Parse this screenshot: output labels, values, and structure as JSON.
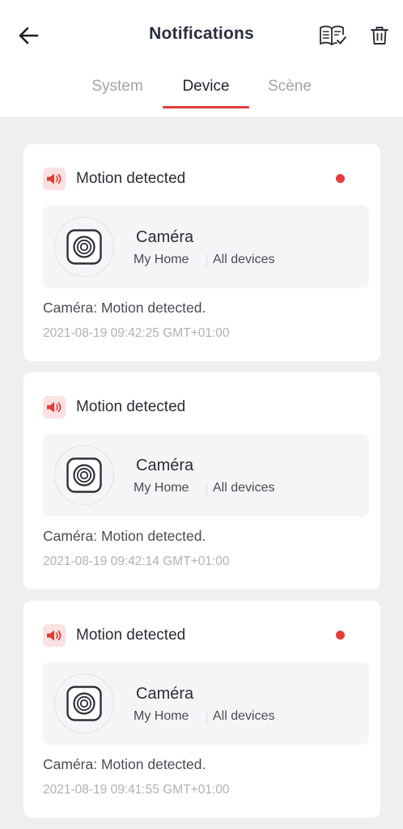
{
  "header": {
    "title": "Notifications",
    "back_icon": "arrow-left-icon",
    "mark_read_icon": "book-check-icon",
    "delete_icon": "trash-icon"
  },
  "tabs": [
    {
      "label": "System",
      "active": false
    },
    {
      "label": "Device",
      "active": true
    },
    {
      "label": "Scène",
      "active": false
    }
  ],
  "colors": {
    "accent": "#e23c3c",
    "title": "#2a2f3d",
    "background": "#efefef",
    "card": "#ffffff",
    "muted": "#b0b0b6"
  },
  "notifications": [
    {
      "title": "Motion detected",
      "unread": true,
      "device_name": "Caméra",
      "home": "My Home",
      "group": "All devices",
      "message": "Caméra: Motion detected.",
      "timestamp": "2021-08-19 09:42:25 GMT+01:00"
    },
    {
      "title": "Motion detected",
      "unread": false,
      "device_name": "Caméra",
      "home": "My Home",
      "group": "All devices",
      "message": "Caméra: Motion detected.",
      "timestamp": "2021-08-19 09:42:14 GMT+01:00"
    },
    {
      "title": "Motion detected",
      "unread": true,
      "device_name": "Caméra",
      "home": "My Home",
      "group": "All devices",
      "message": "Caméra: Motion detected.",
      "timestamp": "2021-08-19 09:41:55 GMT+01:00"
    }
  ]
}
